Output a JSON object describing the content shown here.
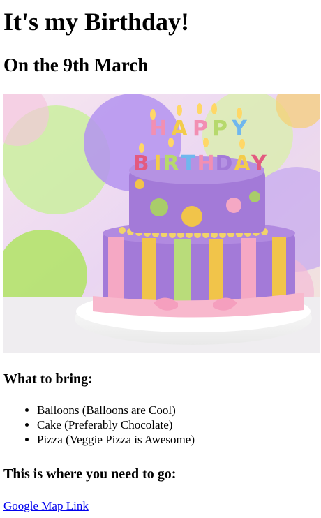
{
  "page": {
    "title": "It's my Birthday!",
    "subtitle": "On the 9th March",
    "image": {
      "alt": "Happy Birthday cake",
      "candle_text": [
        "H",
        "A",
        "P",
        "P",
        "Y",
        "B",
        "I",
        "R",
        "T",
        "H",
        "D",
        "A",
        "Y"
      ],
      "colors": {
        "background": "#e8d6f0",
        "balloon_green": "#b7e07a",
        "balloon_purple": "#c9a7f2",
        "balloon_pink": "#f7c0d4",
        "cake_purple": "#a37ad8",
        "cake_stripe_yellow": "#f1c44a",
        "cake_stripe_pink": "#f5a8c4",
        "ribbon_pink": "#f8b8cd"
      }
    },
    "bring": {
      "heading": "What to bring:",
      "items": [
        "Balloons (Balloons are Cool)",
        "Cake (Preferably Chocolate)",
        "Pizza (Veggie Pizza is Awesome)"
      ]
    },
    "location": {
      "heading": "This is where you need to go:",
      "link_text": "Google Map Link"
    }
  }
}
